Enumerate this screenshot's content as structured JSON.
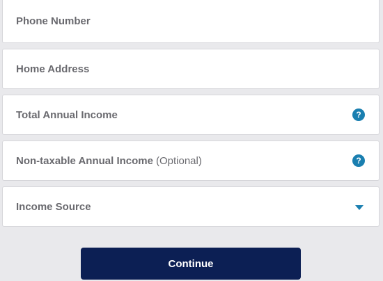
{
  "form": {
    "fields": [
      {
        "label": "Phone Number"
      },
      {
        "label": "Home Address"
      },
      {
        "label": "Total Annual Income",
        "help_icon": "?"
      },
      {
        "label": "Non-taxable Annual Income",
        "suffix": "(Optional)",
        "help_icon": "?"
      },
      {
        "label": "Income Source",
        "type": "select"
      }
    ],
    "continue_label": "Continue"
  },
  "colors": {
    "background": "#e9e9ec",
    "accent": "#1a7fb0",
    "primary_button": "#0c1f54"
  },
  "icons": {
    "help": "help-icon",
    "dropdown": "chevron-down-icon"
  }
}
